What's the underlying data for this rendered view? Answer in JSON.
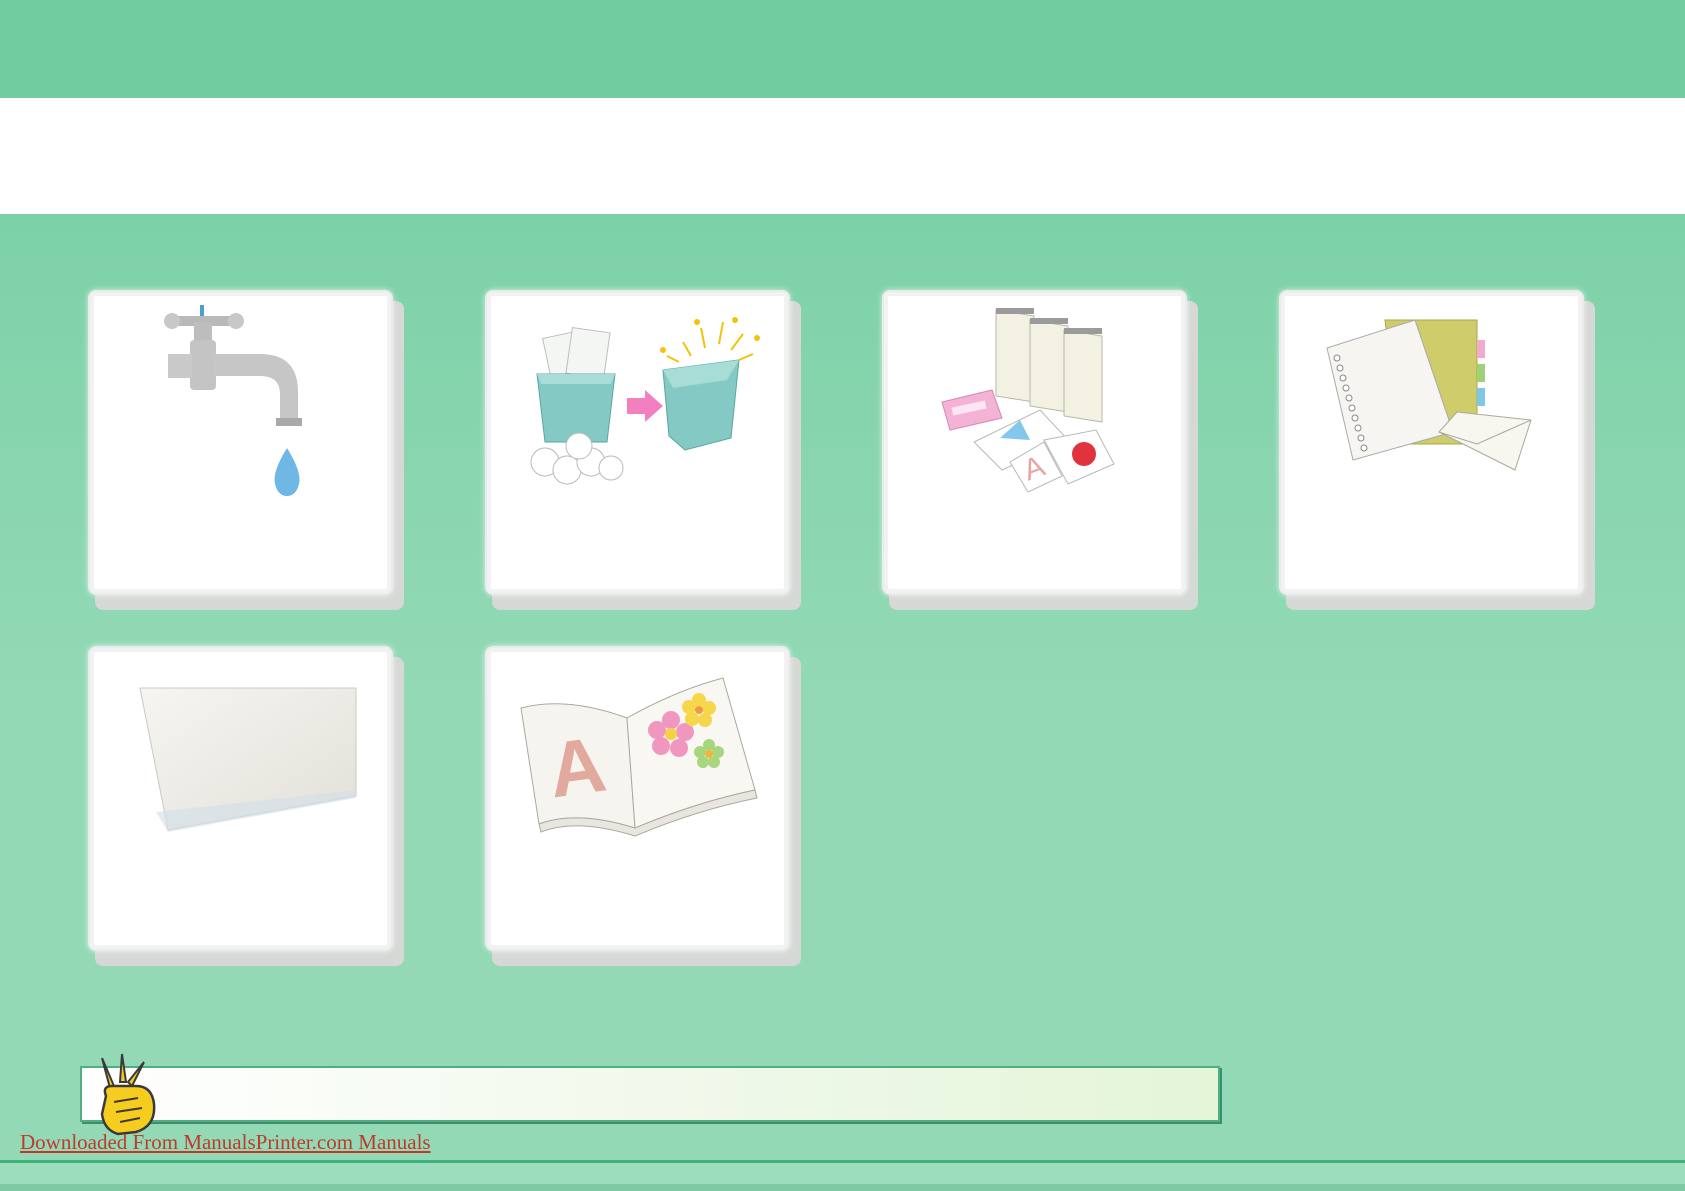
{
  "tiles": [
    {
      "name": "tile-water-faucet",
      "icon": "faucet-icon"
    },
    {
      "name": "tile-trash-before-after",
      "icon": "trash-bin-icon"
    },
    {
      "name": "tile-document-stacks",
      "icon": "document-stacks-icon"
    },
    {
      "name": "tile-paper-types",
      "icon": "paper-envelope-tabs-icon"
    },
    {
      "name": "tile-blank-sheet",
      "icon": "blank-paper-icon"
    },
    {
      "name": "tile-open-book",
      "icon": "open-book-icon"
    }
  ],
  "tip": {
    "icon": "hand-pointer-icon"
  },
  "footer": {
    "link_text": "Downloaded From ManualsPrinter.com Manuals"
  },
  "colors": {
    "background": "#93d9b6",
    "header": "#6fcd9f",
    "link": "#c0392b"
  }
}
